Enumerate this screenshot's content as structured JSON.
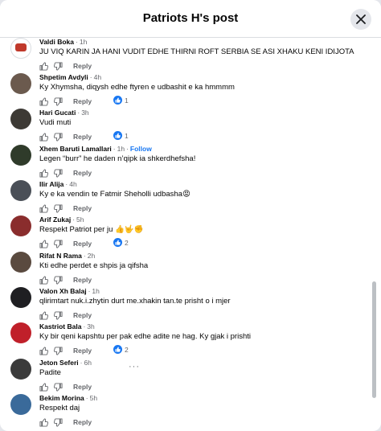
{
  "header": {
    "title": "Patriots H's post",
    "close_icon": "close-icon"
  },
  "comments": [
    {
      "author": "Valdi Boka",
      "time": "1h",
      "text": "JU VIQ KARIN JA HANI VUDIT EDHE THIRNI ROFT SERBIA SE ASI XHAKU KENI IDIJOTA",
      "reply": "Reply"
    },
    {
      "author": "Shpetim Avdyli",
      "time": "4h",
      "text": "Ky Xhymsha, diqysh edhe ftyren e udbashit e ka hmmmm",
      "reply": "Reply",
      "likes": "1"
    },
    {
      "author": "Hari Gucati",
      "time": "3h",
      "text": "Vudi muti",
      "reply": "Reply",
      "likes": "1"
    },
    {
      "author": "Xhem Baruti Lamallari",
      "time": "1h",
      "follow": "Follow",
      "text": "Legen “burr” he daden n’qipk ia shkerdhefsha!",
      "reply": "Reply"
    },
    {
      "author": "Ilir Alija",
      "time": "4h",
      "text": "Ky e ka vendin te Fatmir Sheholli udbasha😡",
      "reply": "Reply"
    },
    {
      "author": "Arif Zukaj",
      "time": "5h",
      "text": "Respekt Patriot per ju 👍🤟✊",
      "reply": "Reply",
      "likes": "2"
    },
    {
      "author": "Rifat N Rama",
      "time": "2h",
      "text": "Kti edhe perdet e shpis ja qifsha",
      "reply": "Reply"
    },
    {
      "author": "Valon Xh Balaj",
      "time": "1h",
      "text": "qlirimtart nuk.i.zhytin durt me.xhakin tan.te prisht o i mjer",
      "reply": "Reply"
    },
    {
      "author": "Kastriot Bala",
      "time": "3h",
      "text": "Ky bir qeni kapshtu per pak edhe adite ne hag. Ky gjak i prishti",
      "reply": "Reply",
      "likes": "2"
    },
    {
      "author": "Jeton Seferi",
      "time": "6h",
      "text": "Padite",
      "reply": "Reply",
      "more": "···"
    },
    {
      "author": "Bekim Morina",
      "time": "5h",
      "text": "Respekt daj",
      "reply": "Reply"
    }
  ],
  "icons": {
    "like": "thumbs-up-icon",
    "reaction": "like-reaction-icon",
    "more": "more-options-icon"
  },
  "colors": {
    "accent": "#1877f2",
    "muted": "#65676b",
    "text": "#050505"
  }
}
